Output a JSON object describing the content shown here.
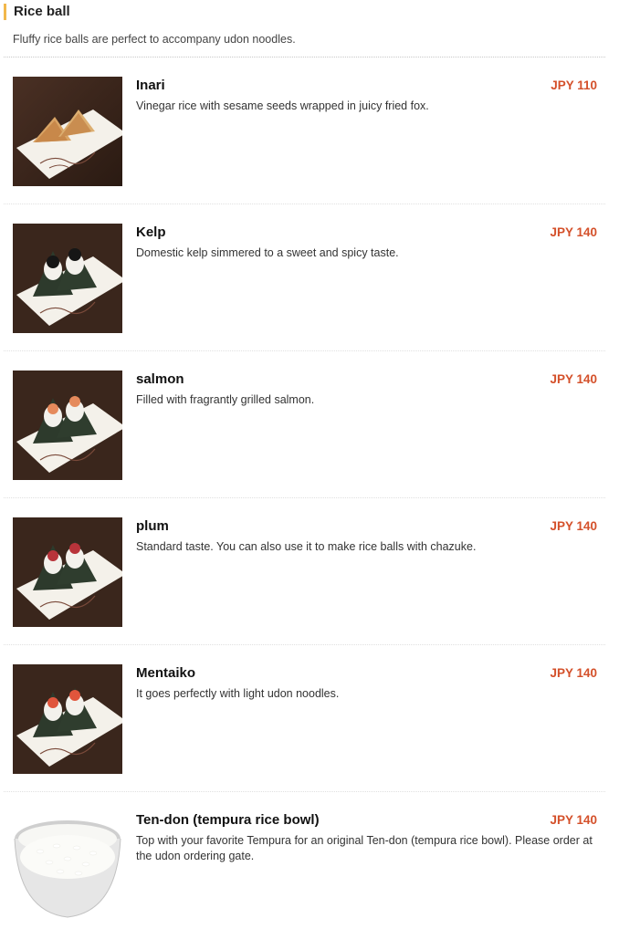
{
  "section": {
    "title": "Rice ball",
    "description": "Fluffy rice balls are perfect to accompany udon noodles."
  },
  "colors": {
    "accent": "#f2b84b",
    "price": "#d4502a"
  },
  "items": [
    {
      "name": "Inari",
      "price": "JPY 110",
      "description": "Vinegar rice with sesame seeds wrapped in juicy fried fox.",
      "image_icon": "inari-photo"
    },
    {
      "name": "Kelp",
      "price": "JPY 140",
      "description": "Domestic kelp simmered to a sweet and spicy taste.",
      "image_icon": "kelp-onigiri-photo"
    },
    {
      "name": "salmon",
      "price": "JPY 140",
      "description": "Filled with fragrantly grilled salmon.",
      "image_icon": "salmon-onigiri-photo"
    },
    {
      "name": "plum",
      "price": "JPY 140",
      "description": "Standard taste. You can also use it to make rice balls with chazuke.",
      "image_icon": "plum-onigiri-photo"
    },
    {
      "name": "Mentaiko",
      "price": "JPY 140",
      "description": "It goes perfectly with light udon noodles.",
      "image_icon": "mentaiko-onigiri-photo"
    },
    {
      "name": "Ten-don (tempura rice bowl)",
      "price": "JPY 140",
      "description": "Top with your favorite Tempura for an original Ten-don (tempura rice bowl). Please order at the udon ordering gate.",
      "image_icon": "rice-bowl-photo"
    }
  ]
}
